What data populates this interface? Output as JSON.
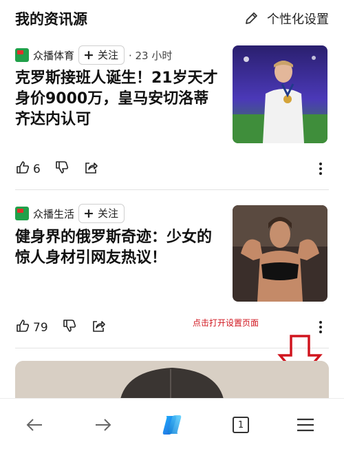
{
  "header": {
    "title": "我的资讯源",
    "settings_label": "个性化设置"
  },
  "feed": [
    {
      "source": "众播体育",
      "follow_label": "关注",
      "time": "· 23 小时",
      "headline": "克罗斯接班人诞生！21岁天才身价9000万，皇马安切洛蒂齐达内认可",
      "likes": "6"
    },
    {
      "source": "众播生活",
      "follow_label": "关注",
      "time": "",
      "headline": "健身界的俄罗斯奇迹：少女的惊人身材引网友热议！",
      "likes": "79"
    }
  ],
  "annotation": {
    "text": "点击打开设置页面",
    "color": "#d0151e"
  },
  "bottom_nav": {
    "tab_count": "1",
    "items": [
      "back-icon",
      "forward-icon",
      "copilot-icon",
      "tabs-icon",
      "menu-icon"
    ]
  }
}
